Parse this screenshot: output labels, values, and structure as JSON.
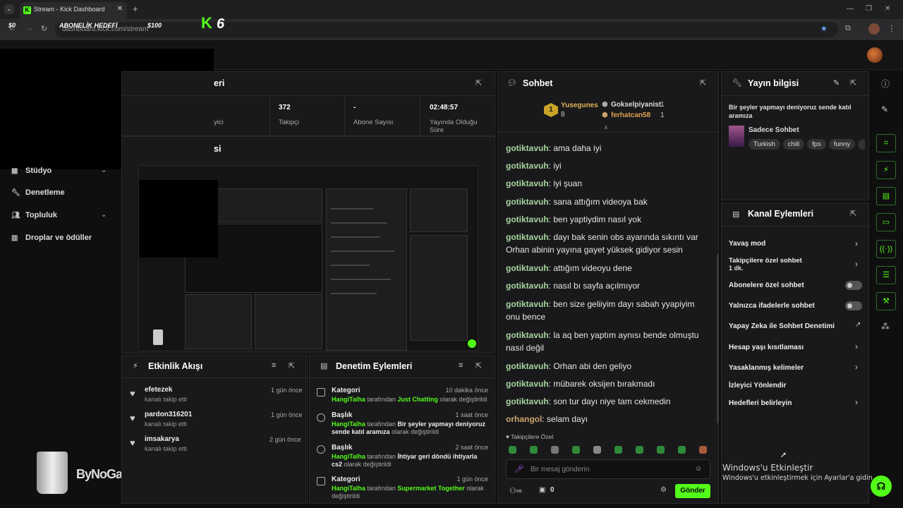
{
  "browser": {
    "tab_title": "Stream - Kick Dashboard",
    "favicon": "K",
    "url": "dashboard.kick.com/stream"
  },
  "overlay": {
    "left_amount": "$0",
    "goal_label": "ABONELİK HEDEFİ",
    "goal_amount": "$100",
    "kick_count": "6",
    "brand": "ByNoGame"
  },
  "sidebar": {
    "items": [
      {
        "label": "Stüdyo",
        "icon": "studio-icon"
      },
      {
        "label": "Denetleme",
        "icon": "wrench-icon"
      },
      {
        "label": "Topluluk",
        "icon": "community-icon"
      },
      {
        "label": "Droplar ve ödüller",
        "icon": "drops-icon"
      }
    ]
  },
  "stats_panel": {
    "title_suffix": "eri",
    "stats": [
      {
        "value": "",
        "label": "yici"
      },
      {
        "value": "372",
        "label": "Takipçi"
      },
      {
        "value": "-",
        "label": "Abone Sayısı"
      },
      {
        "value": "02:48:57",
        "label": "Yayında Olduğu Süre"
      }
    ]
  },
  "preview_panel": {
    "title_suffix": "si"
  },
  "chat": {
    "title": "Sohbet",
    "leaders": [
      {
        "rank": "1",
        "name": "Yusegunes",
        "count": "8"
      },
      {
        "name": "Gokselpiyanist",
        "count": "1"
      },
      {
        "name": "ferhatcan58",
        "count": "1"
      }
    ],
    "messages": [
      {
        "user": "gotiktavuh",
        "text": "ama daha iyi"
      },
      {
        "user": "gotiktavuh",
        "text": "iyi"
      },
      {
        "user": "gotiktavuh",
        "text": "iyi şuan"
      },
      {
        "user": "gotiktavuh",
        "text": "sana attığım videoya bak"
      },
      {
        "user": "gotiktavuh",
        "text": "ben yaptiydim nasıl yok"
      },
      {
        "user": "gotiktavuh",
        "text": "dayı bak senin obs ayarında sıkıntı var Orhan abinin yayına gayet yüksek gidiyor sesin"
      },
      {
        "user": "gotiktavuh",
        "text": "attığım videoyu dene"
      },
      {
        "user": "gotiktavuh",
        "text": "nasıl bı sayfa açılmıyor"
      },
      {
        "user": "gotiktavuh",
        "text": "ben size geliiyim dayı sabah yyapiyim onu bence"
      },
      {
        "user": "gotiktavuh",
        "text": "la aq ben yaptım aynısı bende olmuştu nasıl değil"
      },
      {
        "user": "gotiktavuh",
        "text": "Orhan abi den geliyo"
      },
      {
        "user": "gotiktavuh",
        "text": "mübarek oksijen bırakmadı"
      },
      {
        "user": "gotiktavuh",
        "text": "son tur dayı niye tam cekmedin"
      },
      {
        "user": "orhangol",
        "text": "selam dayı"
      }
    ],
    "mode_label": "Takipçilere Özel",
    "input_placeholder": "Bir mesaj gönderin",
    "bottom_count": "0",
    "send_label": "Gönder"
  },
  "stream_info": {
    "title": "Yayın bilgisi",
    "stream_title": "Bir şeyler yapmayı deniyoruz sende katıl aramıza",
    "category": "Sadece Sohbet",
    "tags": [
      "Turkish",
      "chill",
      "fps",
      "funny"
    ]
  },
  "channel_actions": {
    "title": "Kanal Eylemleri",
    "rows": [
      {
        "label": "Yavaş mod",
        "control": "chevron"
      },
      {
        "label": "Takipçilere özel sohbet",
        "sub": "1 dk.",
        "control": "chevron"
      },
      {
        "label": "Abonelere özel sohbet",
        "control": "toggle"
      },
      {
        "label": "Yalnızca ifadelerle sohbet",
        "control": "toggle"
      },
      {
        "label": "Yapay Zeka ile Sohbet Denetimi",
        "control": "external"
      },
      {
        "label": "Hesap yaşı kısıtlaması",
        "control": "chevron"
      },
      {
        "label": "Yasaklanmış kelimeler",
        "control": "chevron"
      },
      {
        "label": "İzleyici Yönlendir",
        "control": "none"
      },
      {
        "label": "Hedefleri belirleyin",
        "control": "chevron"
      }
    ]
  },
  "activity_feed": {
    "title": "Etkinlik Akışı",
    "items": [
      {
        "name": "efetezek",
        "action": "kanalı takip etti",
        "when": "1 gün önce"
      },
      {
        "name": "pardon316201",
        "action": "kanalı takip etti",
        "when": "1 gün önce"
      },
      {
        "name": "imsakarya",
        "action": "kanalı takip etti",
        "when": "2 gün önce"
      }
    ]
  },
  "moderation": {
    "title": "Denetim Eylemleri",
    "items": [
      {
        "kind": "Kategori",
        "user": "HangiTalha",
        "by": "tarafından",
        "value": "Just Chatting",
        "suffix": "olarak değiştirildi",
        "when": "10 dakika önce"
      },
      {
        "kind": "Başlık",
        "user": "HangiTalha",
        "by": "tarafından",
        "value": "Bir şeyler yapmayı deniyoruz sende katıl aramıza",
        "suffix": "olarak değiştirildi",
        "when": "1 saat önce"
      },
      {
        "kind": "Başlık",
        "user": "HangiTalha",
        "by": "tarafından",
        "value": "İhtiyar geri döndü ihtiyarla cs2",
        "suffix": "olarak değiştirildi",
        "when": "2 saat önce"
      },
      {
        "kind": "Kategori",
        "user": "HangiTalha",
        "by": "tarafından",
        "value": "Supermarket Together",
        "suffix": "olarak değiştirildi",
        "when": "1 gün önce"
      }
    ]
  },
  "windows_activation": {
    "title": "Windows'u Etkinleştir",
    "subtitle": "Windows'u etkinleştirmek için Ayarlar'a gidin."
  },
  "colors": {
    "accent": "#53fc18",
    "background": "#0f0f10",
    "panel": "#19191b"
  }
}
